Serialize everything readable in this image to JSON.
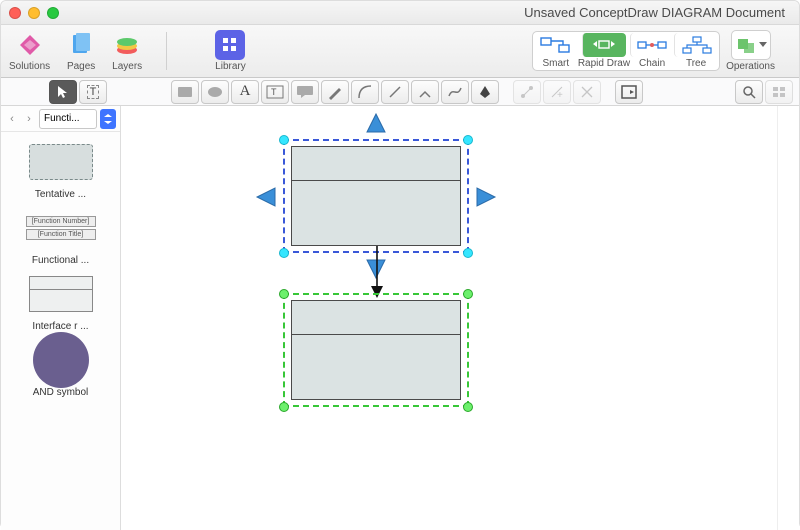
{
  "window": {
    "title": "Unsaved ConceptDraw DIAGRAM Document"
  },
  "toolbar": {
    "left": [
      {
        "label": "Solutions",
        "color": "#d94aa0"
      },
      {
        "label": "Pages",
        "color": "#3a99e8"
      },
      {
        "label": "Layers",
        "color": "#f2c744"
      }
    ],
    "library": {
      "label": "Library",
      "color": "#5c63e6"
    },
    "right": [
      {
        "label": "Smart"
      },
      {
        "label": "Rapid Draw"
      },
      {
        "label": "Chain"
      },
      {
        "label": "Tree"
      }
    ],
    "operations": {
      "label": "Operations"
    }
  },
  "sidebar": {
    "selector": "Functi...",
    "shapes": [
      {
        "label": "Tentative  ..."
      },
      {
        "label": "Functional ...",
        "fn_num": "[Function Number]",
        "fn_title": "[Function Title]"
      },
      {
        "label": "Interface r ..."
      },
      {
        "label": "AND symbol"
      }
    ]
  }
}
